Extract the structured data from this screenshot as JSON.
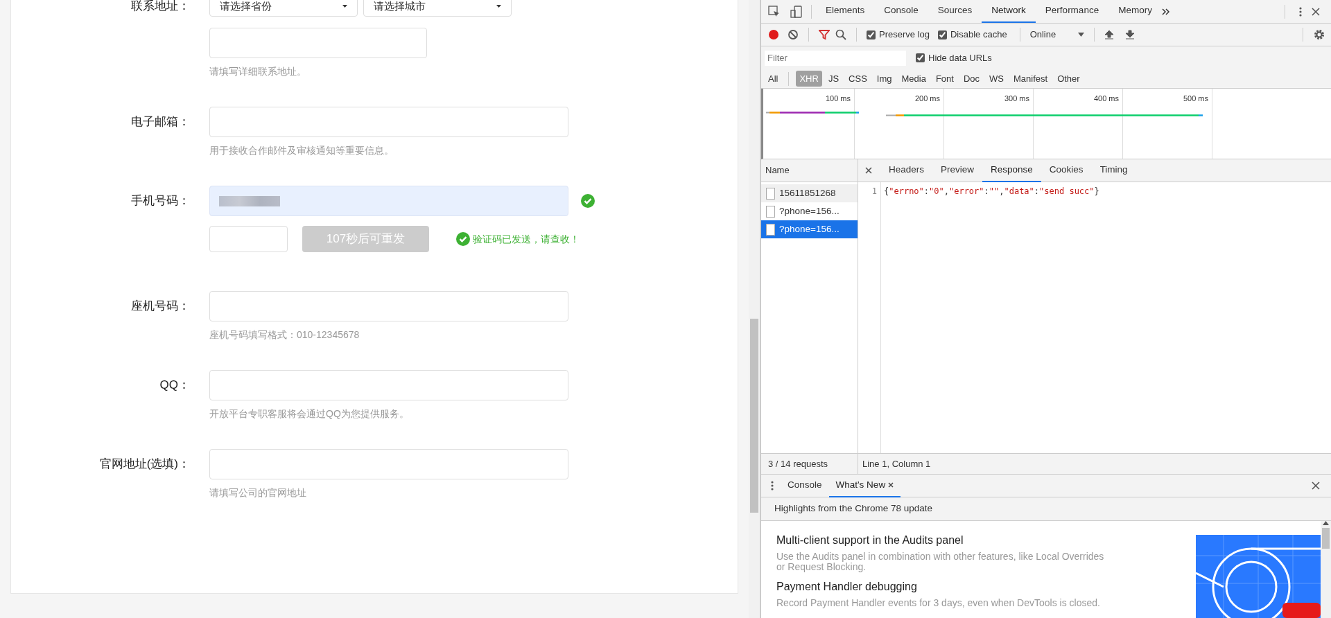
{
  "form": {
    "fields": [
      {
        "kind": "address",
        "label": "联系地址：",
        "selects": [
          "请选择省份",
          "请选择城市"
        ],
        "hint": "请填写详细联系地址。"
      },
      {
        "kind": "text",
        "label": "电子邮箱：",
        "hint": "用于接收合作邮件及审核通知等重要信息。"
      },
      {
        "kind": "phone",
        "label": "手机号码：",
        "verified": true,
        "code_button": {
          "label": "107秒后可重发",
          "disabled": true
        },
        "message": "验证码已发送，请查收！"
      },
      {
        "kind": "text",
        "label": "座机号码：",
        "hint": "座机号码填写格式：010-12345678"
      },
      {
        "kind": "text",
        "label": "QQ：",
        "hint": "开放平台专职客服将会通过QQ为您提供服务。"
      },
      {
        "kind": "text",
        "label": "官网地址(选填)：",
        "hint": "请填写公司的官网地址"
      }
    ]
  },
  "devtools": {
    "tabs": [
      {
        "label": "Elements",
        "selected": false
      },
      {
        "label": "Console",
        "selected": false
      },
      {
        "label": "Sources",
        "selected": false
      },
      {
        "label": "Network",
        "selected": true
      },
      {
        "label": "Performance",
        "selected": false
      },
      {
        "label": "Memory",
        "selected": false
      }
    ],
    "toolbar": {
      "recording": true,
      "options": [
        {
          "label": "Preserve log",
          "checked": true
        },
        {
          "label": "Disable cache",
          "checked": true
        }
      ],
      "throttling": "Online"
    },
    "filter": {
      "placeholder": "Filter",
      "hide_data_urls": {
        "label": "Hide data URLs",
        "checked": true
      }
    },
    "type_filters": [
      {
        "label": "All",
        "selected": false
      },
      {
        "label": "XHR",
        "selected": true
      },
      {
        "label": "JS",
        "selected": false
      },
      {
        "label": "CSS",
        "selected": false
      },
      {
        "label": "Img",
        "selected": false
      },
      {
        "label": "Media",
        "selected": false
      },
      {
        "label": "Font",
        "selected": false
      },
      {
        "label": "Doc",
        "selected": false
      },
      {
        "label": "WS",
        "selected": false
      },
      {
        "label": "Manifest",
        "selected": false
      },
      {
        "label": "Other",
        "selected": false
      }
    ],
    "overview": {
      "ticks": [
        "100 ms",
        "200 ms",
        "300 ms",
        "400 ms",
        "500 ms"
      ]
    },
    "requests": {
      "header": "Name",
      "items": [
        {
          "name": "15611851268",
          "selected": false
        },
        {
          "name": "?phone=156...",
          "selected": false
        },
        {
          "name": "?phone=156...",
          "selected": true
        }
      ],
      "summary": "3 / 14 requests"
    },
    "detail_tabs": [
      {
        "label": "Headers",
        "selected": false
      },
      {
        "label": "Preview",
        "selected": false
      },
      {
        "label": "Response",
        "selected": true
      },
      {
        "label": "Cookies",
        "selected": false
      },
      {
        "label": "Timing",
        "selected": false
      }
    ],
    "response": {
      "lines": [
        {
          "number": "1",
          "text": "{\"errno\":\"0\",\"error\":\"\",\"data\":\"send succ\"}"
        }
      ],
      "cursor": "Line 1, Column 1"
    },
    "drawer": {
      "tabs": [
        {
          "label": "Console",
          "selected": false
        },
        {
          "label": "What's New",
          "selected": true
        }
      ],
      "banner": "Highlights from the Chrome 78 update",
      "items": [
        {
          "title": "Multi-client support in the Audits panel",
          "description": "Use the Audits panel in combination with other features, like Local Overrides or Request Blocking."
        },
        {
          "title": "Payment Handler debugging",
          "description": "Record Payment Handler events for 3 days, even when DevTools is closed."
        }
      ]
    }
  }
}
